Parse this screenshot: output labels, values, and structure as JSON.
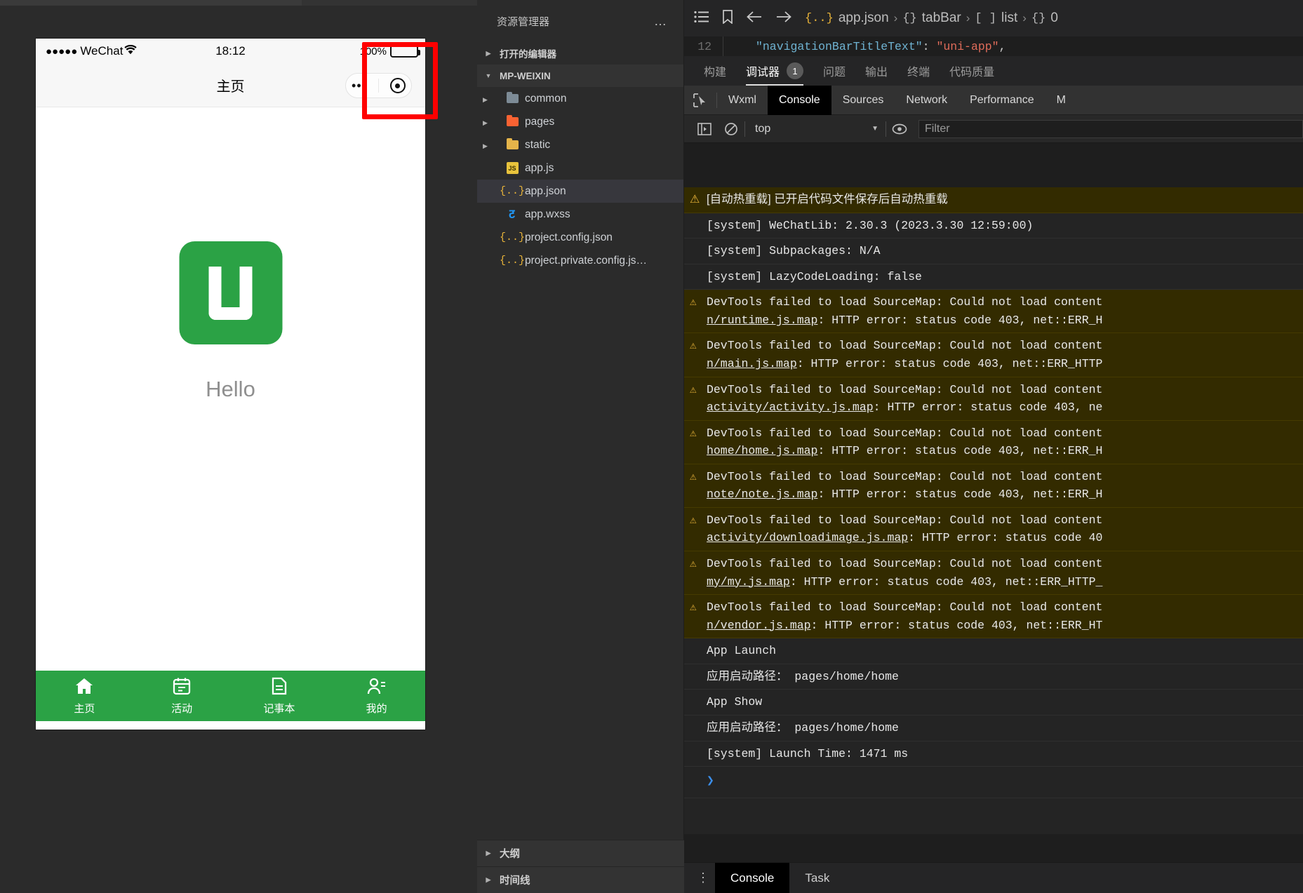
{
  "simulator": {
    "status_bar": {
      "signal": "●●●●●",
      "carrier": "WeChat",
      "wifi_icon": "wifi-icon",
      "time": "18:12",
      "battery_pct": "100%"
    },
    "nav_title": "主页",
    "capsule": {
      "more_dots": "•••",
      "target_icon": "target-icon"
    },
    "logo_letter": "U",
    "hello_text": "Hello",
    "brand_color": "#2ba245",
    "tabbar": [
      {
        "icon": "home-icon",
        "glyph": "⌂",
        "label": "主页"
      },
      {
        "icon": "calendar-icon",
        "glyph": "▤",
        "label": "活动"
      },
      {
        "icon": "note-icon",
        "glyph": "▤",
        "label": "记事本"
      },
      {
        "icon": "user-icon",
        "glyph": "☻",
        "label": "我的"
      }
    ],
    "highlight_color": "#ff0000"
  },
  "explorer": {
    "title": "资源管理器",
    "more_label": "…",
    "sections": [
      {
        "label": "打开的编辑器",
        "expanded": false,
        "caret": "▶"
      },
      {
        "label": "MP-WEIXIN",
        "expanded": true,
        "caret": "▼"
      }
    ],
    "files": [
      {
        "name": "common",
        "icon": "folder-grey-icon",
        "kind": "folder",
        "caret": "▶",
        "selected": false
      },
      {
        "name": "pages",
        "icon": "folder-orange-icon",
        "kind": "folder",
        "caret": "▶",
        "selected": false
      },
      {
        "name": "static",
        "icon": "folder-yellow-icon",
        "kind": "folder",
        "caret": "▶",
        "selected": false
      },
      {
        "name": "app.js",
        "icon": "js-file-icon",
        "kind": "js",
        "caret": "",
        "selected": false
      },
      {
        "name": "app.json",
        "icon": "json-file-icon",
        "kind": "json",
        "caret": "",
        "selected": true
      },
      {
        "name": "app.wxss",
        "icon": "wxss-file-icon",
        "kind": "wxss",
        "caret": "",
        "selected": false
      },
      {
        "name": "project.config.json",
        "icon": "json-file-icon",
        "kind": "json",
        "caret": "",
        "selected": false
      },
      {
        "name": "project.private.config.js…",
        "icon": "json-file-icon",
        "kind": "json",
        "caret": "",
        "selected": false
      }
    ],
    "footer": [
      {
        "label": "大纲",
        "caret": "▶"
      },
      {
        "label": "时间线",
        "caret": "▶"
      }
    ]
  },
  "editor": {
    "breadcrumb_icons": [
      "list-icon",
      "bookmark-icon",
      "back-arrow-icon",
      "forward-arrow-icon"
    ],
    "breadcrumb": [
      {
        "badge": "{..}",
        "label": "app.json"
      },
      {
        "badge": "{}",
        "label": "tabBar"
      },
      {
        "badge": "[ ]",
        "label": "list"
      },
      {
        "badge": "{}",
        "label": "0"
      }
    ],
    "separator": "›",
    "code": {
      "line_no": "12",
      "key": "\"navigationBarTitleText\"",
      "colon": ": ",
      "value": "\"uni-app\"",
      "trail": ","
    }
  },
  "panel_tabs": [
    {
      "label": "构建",
      "active": false,
      "badge": ""
    },
    {
      "label": "调试器",
      "active": true,
      "badge": "1"
    },
    {
      "label": "问题",
      "active": false,
      "badge": ""
    },
    {
      "label": "输出",
      "active": false,
      "badge": ""
    },
    {
      "label": "终端",
      "active": false,
      "badge": ""
    },
    {
      "label": "代码质量",
      "active": false,
      "badge": ""
    }
  ],
  "devtools_tabs": [
    {
      "label": "Wxml",
      "active": false
    },
    {
      "label": "Console",
      "active": true
    },
    {
      "label": "Sources",
      "active": false
    },
    {
      "label": "Network",
      "active": false
    },
    {
      "label": "Performance",
      "active": false
    },
    {
      "label": "M",
      "active": false
    }
  ],
  "console_toolbar": {
    "inspect_icon": "inspect-cursor-icon",
    "sidebar_icon": "console-sidebar-icon",
    "clear_icon": "clear-console-icon",
    "context": "top",
    "context_caret": "▼",
    "eye_icon": "live-expression-icon",
    "filter_placeholder": "Filter",
    "filter_value": ""
  },
  "console_lines": [
    {
      "level": "warning",
      "icon": "warning-icon",
      "cjk": true,
      "text": "[自动热重载] 已开启代码文件保存后自动热重载"
    },
    {
      "level": "info",
      "icon": "",
      "cjk": false,
      "text": "[system] WeChatLib: 2.30.3 (2023.3.30 12:59:00)"
    },
    {
      "level": "info",
      "icon": "",
      "cjk": false,
      "text": "[system] Subpackages: N/A"
    },
    {
      "level": "info",
      "icon": "",
      "cjk": false,
      "text": "[system] LazyCodeLoading: false"
    },
    {
      "level": "warning",
      "icon": "warning-icon",
      "cjk": false,
      "text": "DevTools failed to load SourceMap: Could not load content",
      "link": "n/runtime.js.map",
      "tail": ": HTTP error: status code 403, net::ERR_H"
    },
    {
      "level": "warning",
      "icon": "warning-icon",
      "cjk": false,
      "text": "DevTools failed to load SourceMap: Could not load content",
      "link": "n/main.js.map",
      "tail": ": HTTP error: status code 403, net::ERR_HTTP"
    },
    {
      "level": "warning",
      "icon": "warning-icon",
      "cjk": false,
      "text": "DevTools failed to load SourceMap: Could not load content",
      "link": "activity/activity.js.map",
      "tail": ": HTTP error: status code 403, ne"
    },
    {
      "level": "warning",
      "icon": "warning-icon",
      "cjk": false,
      "text": "DevTools failed to load SourceMap: Could not load content",
      "link": "home/home.js.map",
      "tail": ": HTTP error: status code 403, net::ERR_H"
    },
    {
      "level": "warning",
      "icon": "warning-icon",
      "cjk": false,
      "text": "DevTools failed to load SourceMap: Could not load content",
      "link": "note/note.js.map",
      "tail": ": HTTP error: status code 403, net::ERR_H"
    },
    {
      "level": "warning",
      "icon": "warning-icon",
      "cjk": false,
      "text": "DevTools failed to load SourceMap: Could not load content",
      "link": "activity/downloadimage.js.map",
      "tail": ": HTTP error: status code 40"
    },
    {
      "level": "warning",
      "icon": "warning-icon",
      "cjk": false,
      "text": "DevTools failed to load SourceMap: Could not load content",
      "link": "my/my.js.map",
      "tail": ": HTTP error: status code 403, net::ERR_HTTP_"
    },
    {
      "level": "warning",
      "icon": "warning-icon",
      "cjk": false,
      "text": "DevTools failed to load SourceMap: Could not load content",
      "link": "n/vendor.js.map",
      "tail": ": HTTP error: status code 403, net::ERR_HT"
    },
    {
      "level": "info",
      "icon": "",
      "cjk": false,
      "text": "App Launch"
    },
    {
      "level": "info",
      "icon": "",
      "cjk": true,
      "text": "应用启动路径： pages/home/home"
    },
    {
      "level": "info",
      "icon": "",
      "cjk": false,
      "text": "App Show"
    },
    {
      "level": "info",
      "icon": "",
      "cjk": true,
      "text": "应用启动路径： pages/home/home"
    },
    {
      "level": "info",
      "icon": "",
      "cjk": false,
      "text": "[system] Launch Time: 1471 ms"
    }
  ],
  "console_prompt": "❯",
  "bottom_bar": {
    "kebab_icon": "kebab-menu-icon",
    "tabs": [
      {
        "label": "Console",
        "active": true
      },
      {
        "label": "Task",
        "active": false
      }
    ]
  }
}
